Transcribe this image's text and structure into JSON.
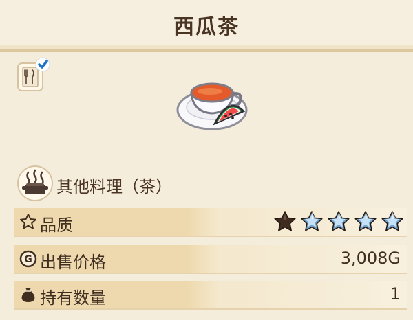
{
  "header": {
    "title": "西瓜茶"
  },
  "item": {
    "image_icon": "watermelon-tea-icon",
    "recipe_icon": "recipe-book-checked-icon",
    "category_icon": "cooking-pot-icon",
    "category": "其他料理（茶）"
  },
  "stats": {
    "quality": {
      "label": "品质",
      "icon": "star-outline-icon",
      "rating": 1,
      "max_rating": 5
    },
    "price": {
      "label": "出售价格",
      "icon": "gold-coin-icon",
      "value": "3,008G"
    },
    "count": {
      "label": "持有数量",
      "icon": "money-bag-icon",
      "value": "1"
    }
  },
  "colors": {
    "background": "#f5eddc",
    "title_text": "#4a3424",
    "row_highlight": "#eed9ae",
    "star_filled": "#3f2b20",
    "star_empty": "#6f9fc7"
  }
}
